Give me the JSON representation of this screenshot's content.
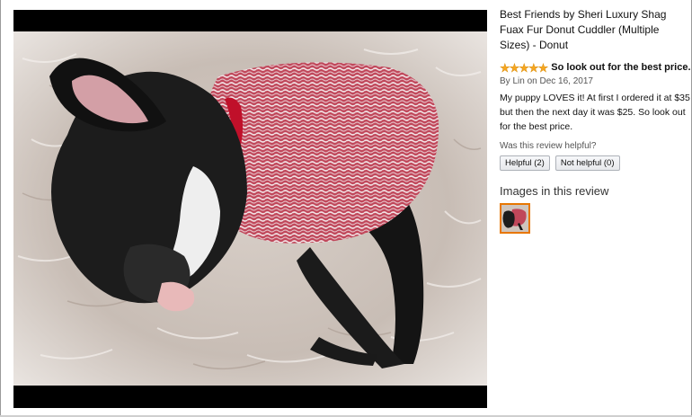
{
  "top_clip_text": "· ··· ··",
  "product": {
    "title": "Best Friends by Sheri Luxury Shag Fuax Fur Donut Cuddler (Multiple Sizes) - Donut"
  },
  "review": {
    "rating": 5,
    "stars": [
      "★",
      "★",
      "★",
      "★",
      "★"
    ],
    "headline": "So look out for the best price.",
    "byline": "By Lin on Dec 16, 2017",
    "body": "My puppy LOVES it! At first I ordered it at $35 but then the next day it was $25. So look out for the best price.",
    "helpful_question": "Was this review helpful?",
    "helpful_button": "Helpful (2)",
    "not_helpful_button": "Not helpful (0)"
  },
  "images_section": {
    "heading": "Images in this review",
    "thumbnail_count": 1
  },
  "colors": {
    "accent_star": "#f5a623",
    "thumbnail_border": "#e77600",
    "viewer_background": "#000000"
  }
}
